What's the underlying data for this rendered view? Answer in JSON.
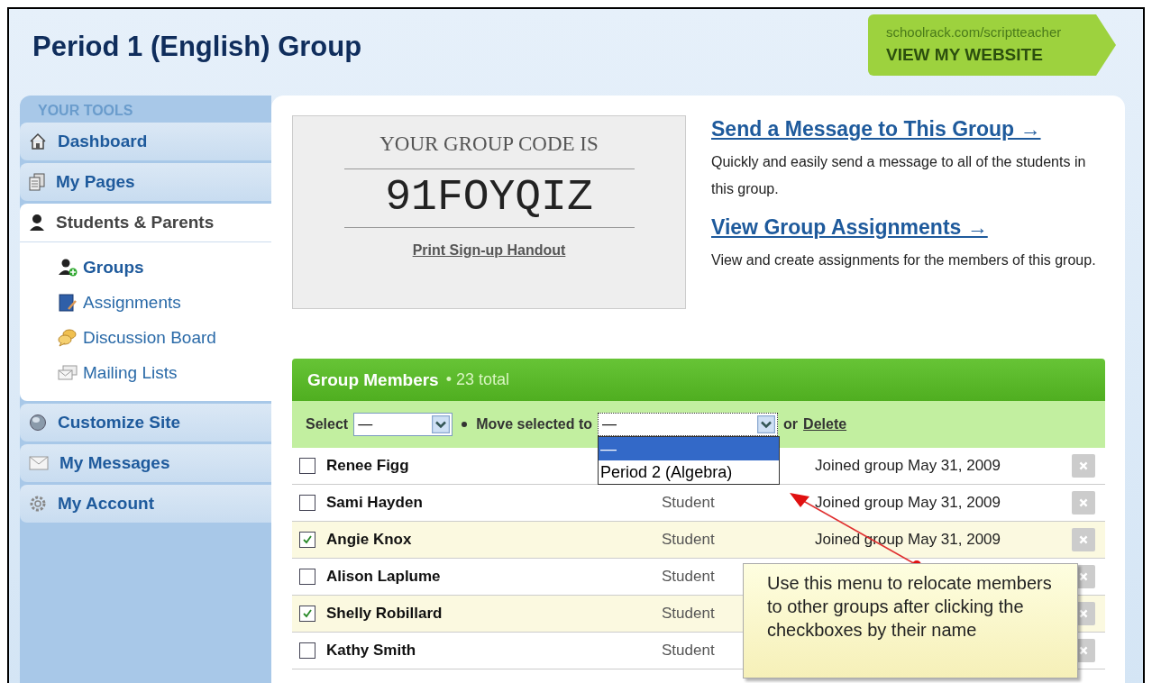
{
  "title": "Period 1 (English) Group",
  "website": {
    "url": "schoolrack.com/scriptteacher",
    "label": "VIEW MY WEBSITE"
  },
  "sidebar": {
    "heading": "YOUR TOOLS",
    "items": [
      {
        "label": "Dashboard",
        "selected": false
      },
      {
        "label": "My Pages",
        "selected": false
      },
      {
        "label": "Students & Parents",
        "selected": true,
        "children": [
          {
            "label": "Groups",
            "selected": true
          },
          {
            "label": "Assignments",
            "selected": false
          },
          {
            "label": "Discussion Board",
            "selected": false
          },
          {
            "label": "Mailing Lists",
            "selected": false
          }
        ]
      },
      {
        "label": "Customize Site",
        "selected": false
      },
      {
        "label": "My Messages",
        "selected": false
      },
      {
        "label": "My Account",
        "selected": false
      }
    ]
  },
  "code_card": {
    "heading": "YOUR GROUP CODE IS",
    "code": "91FOYQIZ",
    "link": "Print Sign-up Handout"
  },
  "actions": [
    {
      "link": "Send a Message to This Group →",
      "description": "Quickly and easily send a message to all of the students in this group."
    },
    {
      "link": "View Group Assignments →",
      "description": "View and create assignments for the members of this group."
    }
  ],
  "members": {
    "title": "Group Members",
    "count": "• 23 total",
    "toolbar": {
      "select_label": "Select",
      "select_value": "—",
      "move_label": "Move selected to",
      "move_value": "—",
      "or": "or",
      "delete": "Delete"
    },
    "move_options": [
      {
        "label": "—",
        "selected": true
      },
      {
        "label": "Period 2 (Algebra)",
        "selected": false
      }
    ],
    "rows": [
      {
        "name": "Renee Figg",
        "checked": false,
        "joined": "Joined group May 31, 2009"
      },
      {
        "name": "Sami Hayden",
        "checked": false,
        "role": "Student",
        "joined": "Joined group May 31, 2009"
      },
      {
        "name": "Angie Knox",
        "checked": true,
        "role": "Student",
        "joined": "Joined group May 31, 2009"
      },
      {
        "name": "Alison Laplume",
        "checked": false,
        "role": "Student"
      },
      {
        "name": "Shelly Robillard",
        "checked": true,
        "role": "Student"
      },
      {
        "name": "Kathy Smith",
        "checked": false,
        "role": "Student"
      }
    ]
  },
  "callout": {
    "text": "Use this menu to relocate members to other groups after clicking the checkboxes by their name"
  }
}
